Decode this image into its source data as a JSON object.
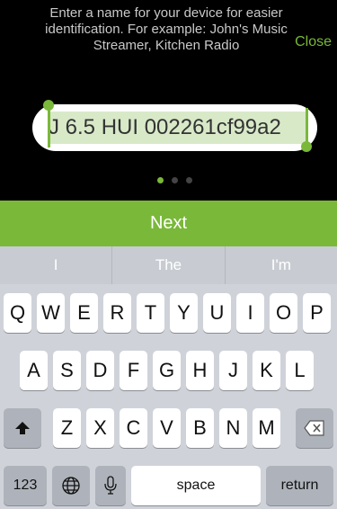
{
  "instructions": "Enter a name for your device for easier identification. For example: John's Music Streamer, Kitchen Radio",
  "close_label": "Close",
  "device_name": "J 6.5 HUI 002261cf99a2",
  "pager": {
    "total": 3,
    "active": 1
  },
  "next_label": "Next",
  "suggestions": [
    "I",
    "The",
    "I'm"
  ],
  "keyboard": {
    "row1": [
      "Q",
      "W",
      "E",
      "R",
      "T",
      "Y",
      "U",
      "I",
      "O",
      "P"
    ],
    "row2": [
      "A",
      "S",
      "D",
      "F",
      "G",
      "H",
      "J",
      "K",
      "L"
    ],
    "row3": [
      "Z",
      "X",
      "C",
      "V",
      "B",
      "N",
      "M"
    ],
    "numbers_label": "123",
    "space_label": "space",
    "return_label": "return"
  },
  "icons": {
    "shift": "shift-icon",
    "backspace": "backspace-icon",
    "globe": "globe-icon",
    "mic": "microphone-icon"
  },
  "colors": {
    "accent": "#7ab83a",
    "selection": "#d8e9c8",
    "keyboard_bg": "#cfd3d9"
  }
}
